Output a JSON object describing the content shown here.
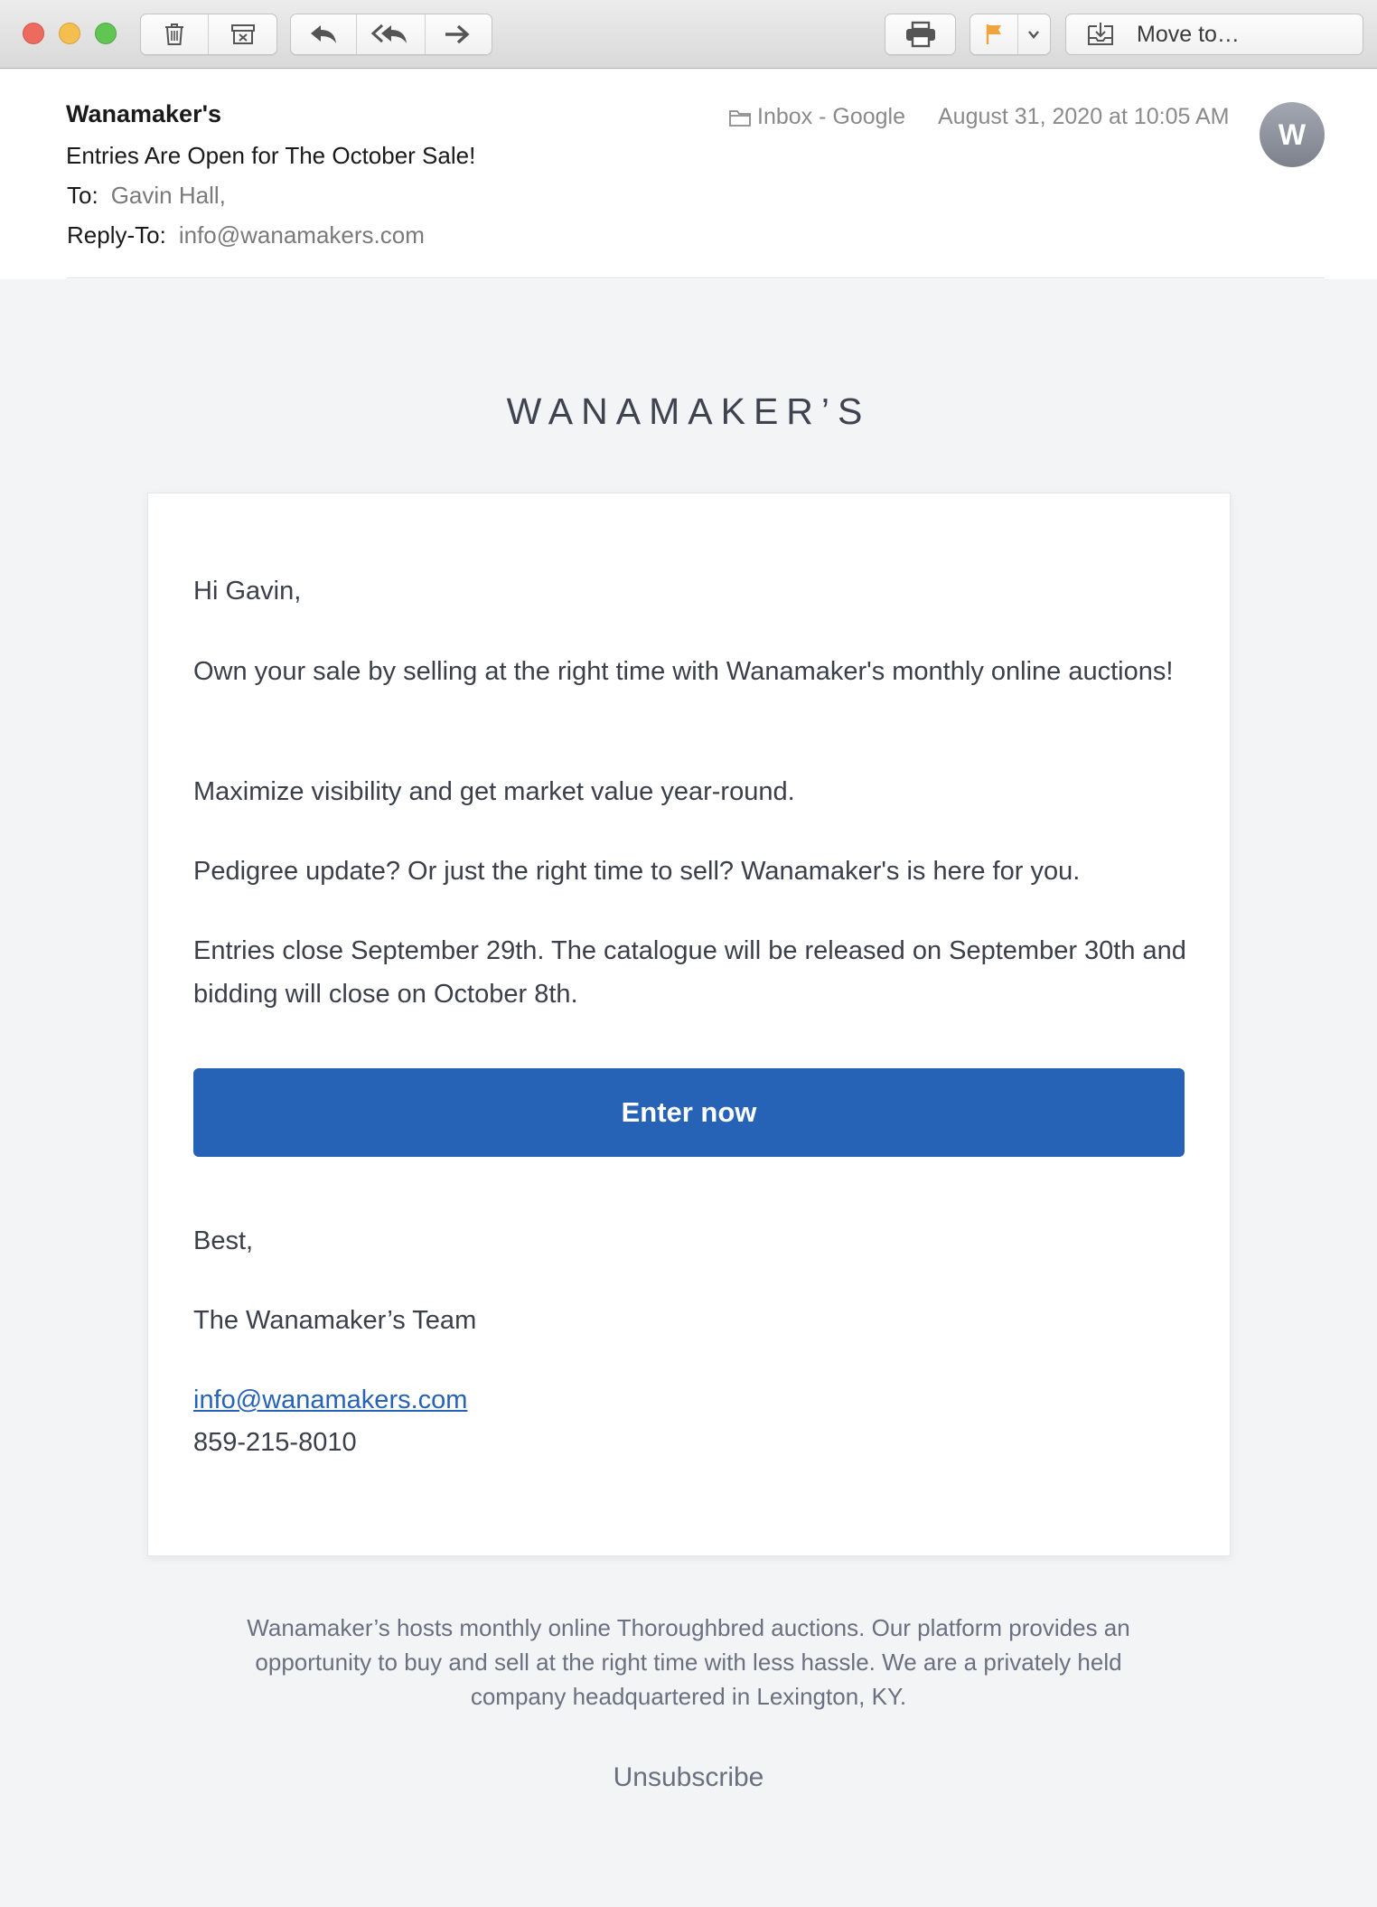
{
  "toolbar": {
    "move_to_label": "Move to…",
    "icons": [
      "trash-icon",
      "archive-icon",
      "reply-icon",
      "reply-all-icon",
      "forward-icon",
      "print-icon",
      "flag-icon",
      "chevron-down-icon",
      "move-to-icon"
    ],
    "flag_color": "#f0a43b"
  },
  "header": {
    "sender": "Wanamaker's",
    "subject": "Entries Are Open for The October Sale!",
    "to_label": "To:",
    "to_value": "Gavin Hall,",
    "reply_to_label": "Reply-To:",
    "reply_to_value": "info@wanamakers.com",
    "mailbox": "Inbox - Google",
    "date": "August 31, 2020 at 10:05 AM",
    "avatar_initial": "W"
  },
  "email": {
    "brand": "WANAMAKER’S",
    "greeting": "Hi Gavin,",
    "paragraph1": "Own your sale by selling at the right time with Wanamaker's monthly online auctions!",
    "paragraph2": "Maximize visibility and get market value year-round.",
    "paragraph3": "Pedigree update? Or just the right time to sell? Wanamaker's is here for you.",
    "paragraph4": "Entries close September 29th. The catalogue will be released on September 30th and bidding will close on October 8th.",
    "cta_label": "Enter now",
    "cta_color": "#2663b7",
    "signoff": "Best,",
    "team": "The Wanamaker’s Team",
    "contact_email": "info@wanamakers.com",
    "contact_phone": "859-215-8010",
    "footer": "Wanamaker’s hosts monthly online Thoroughbred auctions. Our platform provides an opportunity to buy and sell at the right time with less hassle. We are a privately held company headquartered in Lexington, KY.",
    "unsubscribe": "Unsubscribe"
  }
}
